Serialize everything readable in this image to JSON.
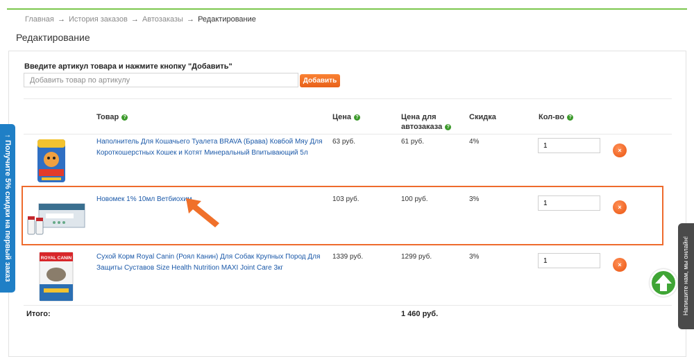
{
  "breadcrumb": {
    "items": [
      "Главная",
      "История заказов",
      "Автозаказы"
    ],
    "current": "Редактирование",
    "separator": "→"
  },
  "page_title": "Редактирование",
  "add_form": {
    "label": "Введите артикул товара и нажмите кнопку \"Добавить\"",
    "placeholder": "Добавить товар по артикулу",
    "value": "",
    "button_label": "Добавить"
  },
  "table": {
    "headers": {
      "product": "Товар",
      "price": "Цена",
      "auto_price_line1": "Цена для",
      "auto_price_line2": "автозаказа",
      "discount": "Скидка",
      "quantity": "Кол-во"
    },
    "rows": [
      {
        "name": "Наполнитель Для Кошачьего Туалета BRAVA (Брава) Ковбой Мяу Для Короткошерстных Кошек и Котят Минеральный Впитывающий 5л",
        "price": "63 руб.",
        "auto_price": "61 руб.",
        "discount": "4%",
        "quantity": "1",
        "image_icon": "cat-litter-bag-image"
      },
      {
        "name": "Новомек 1% 10мл Ветбиохим",
        "price": "103 руб.",
        "auto_price": "100 руб.",
        "discount": "3%",
        "quantity": "1",
        "image_icon": "medicine-box-vials-image"
      },
      {
        "name": "Сухой Корм Royal Canin (Роял Канин) Для Собак Крупных Пород Для Защиты Суставов Size Health Nutrition MAXI Joint Care 3кг",
        "price": "1339 руб.",
        "auto_price": "1299 руб.",
        "discount": "3%",
        "quantity": "1",
        "image_icon": "dog-food-bag-image",
        "image_brand": "ROYAL CANIN"
      }
    ],
    "delete_symbol": "×",
    "help_symbol": "?"
  },
  "total": {
    "label": "Итого:",
    "value": "1 460 руб."
  },
  "promo_tab": {
    "label": "↑ Получите 5% скидки на первый заказ"
  },
  "chat_tab": {
    "label": "Напишите нам, мы онлайн!"
  },
  "colors": {
    "accent_orange": "#f0702a",
    "link_blue": "#1a58a8",
    "help_green": "#3c9a2b",
    "promo_blue": "#1f7fc6",
    "top_line_green": "#7bc74d"
  },
  "icons": {
    "scroll_up": "arrow-up-circle-icon",
    "annotation": "orange-arrow-pointer-icon",
    "help": "question-circle-icon",
    "delete": "close-circle-icon"
  }
}
